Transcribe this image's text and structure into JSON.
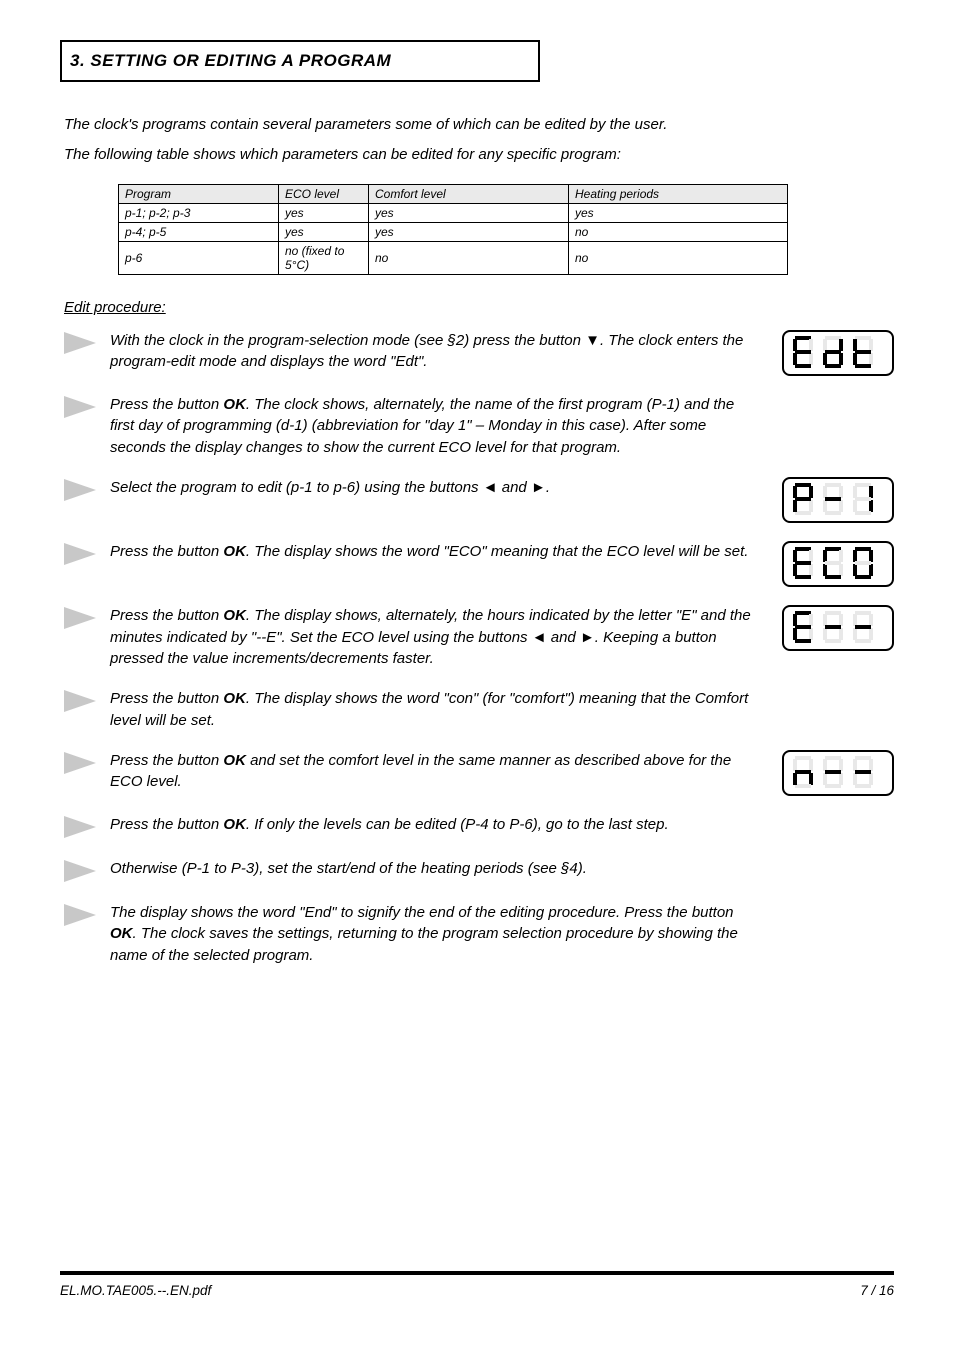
{
  "header": {
    "title": "3. SETTING OR EDITING A PROGRAM"
  },
  "intro": {
    "line1": "The clock's programs contain several parameters some of which can be edited by the user.",
    "line2": "The following table shows which parameters can be edited for any specific program:"
  },
  "table": {
    "headers": [
      "Program",
      "ECO level",
      "Comfort level",
      "Heating periods"
    ],
    "rows": [
      [
        " p-1; p-2; p-3",
        "yes",
        "yes",
        "yes"
      ],
      [
        " p-4; p-5",
        "yes",
        "yes",
        "no"
      ],
      [
        " p-6",
        "no (fixed to 5°C)",
        "no",
        "no"
      ]
    ]
  },
  "section_heading": "Edit procedure:",
  "steps": [
    {
      "text": "With the clock in the program-selection mode (see §2) press the button {Down-arrow}. The clock enters the program-edit mode and displays the word \"Edt\".",
      "lcd": "Edt"
    },
    {
      "text": "Press the button {OK}. The clock shows, alternately, the name of the first program (P-1) and the first day of programming (d-1) (abbreviation for \"day 1\" – Monday in this case). After some seconds the display changes to show the current ECO level for that program.",
      "lcd": null
    },
    {
      "text": "Select the program to edit (p-1 to p-6) using the buttons {Left-arrow} and {Right-arrow}.",
      "lcd": "P-1"
    },
    {
      "text": "Press the button {OK}. The display shows the word \"ECO\" meaning that the ECO level will be set.",
      "lcd": "ECO"
    },
    {
      "text": "Press the button {OK}. The display shows, alternately, the hours indicated by the letter \"E\" and the minutes indicated by \"--E\". Set the ECO level using the buttons {Left-arrow} and {Right-arrow}. Keeping a button pressed the value increments/decrements faster.",
      "lcd": "E--"
    },
    {
      "text": "Press the button {OK}. The display shows the word \"con\" (for \"comfort\") meaning that the Comfort level will be set.",
      "lcd": null
    },
    {
      "text": "Press the button {OK} and set the comfort level in the same manner as described above for the ECO level.",
      "lcd": "n--"
    },
    {
      "text": "Press the button {OK}. If only the levels can be edited (P-4 to P-6), go to the last step.",
      "lcd": null
    },
    {
      "text": "Otherwise (P-1 to P-3), set the start/end of the heating periods (see §4).",
      "lcd": null
    },
    {
      "text": "The display shows the word \"End\" to signify the end of the editing procedure. Press the button {OK}. The clock saves the settings, returning to the program selection procedure by showing the name of the selected program.",
      "lcd": null
    }
  ],
  "footer": {
    "left": "EL.MO.TAE005.--.EN.pdf",
    "right": "7 / 16"
  }
}
